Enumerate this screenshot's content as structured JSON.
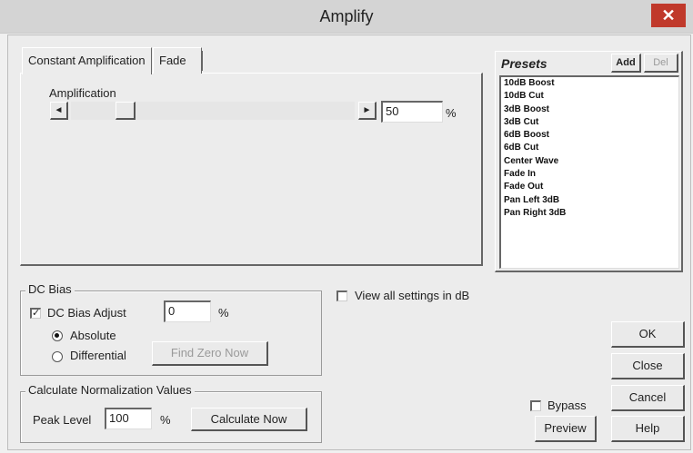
{
  "window": {
    "title": "Amplify",
    "close_glyph": "✕"
  },
  "tabs": [
    {
      "label": "Constant Amplification",
      "active": true
    },
    {
      "label": "Fade",
      "active": false
    }
  ],
  "amplification": {
    "label": "Amplification",
    "value": "50",
    "unit": "%",
    "left_arrow": "◄",
    "right_arrow": "►",
    "slider_level_percent": 17
  },
  "presets": {
    "title": "Presets",
    "add_label": "Add",
    "del_label": "Del",
    "items": [
      "10dB Boost",
      "10dB Cut",
      "3dB Boost",
      "3dB Cut",
      "6dB Boost",
      "6dB Cut",
      "Center Wave",
      "Fade In",
      "Fade Out",
      "Pan Left 3dB",
      "Pan Right 3dB"
    ]
  },
  "dc_bias": {
    "group_label": "DC Bias",
    "adjust_label": "DC Bias Adjust",
    "adjust_checked": true,
    "check_glyph": "✓",
    "value": "0",
    "unit": "%",
    "absolute_label": "Absolute",
    "differential_label": "Differential",
    "find_zero_label": "Find Zero Now"
  },
  "view_db": {
    "label": "View all settings in dB",
    "checked": false
  },
  "normalization": {
    "group_label": "Calculate Normalization Values",
    "peak_label": "Peak Level",
    "peak_value": "100",
    "unit": "%",
    "calculate_label": "Calculate Now"
  },
  "buttons": {
    "ok": "OK",
    "close": "Close",
    "cancel": "Cancel",
    "help": "Help",
    "preview": "Preview"
  },
  "bypass": {
    "label": "Bypass",
    "checked": false
  },
  "colors": {
    "close_button": "#c0392b",
    "titlebar": "#d4d4d4",
    "dialog_bg": "#ececec"
  }
}
